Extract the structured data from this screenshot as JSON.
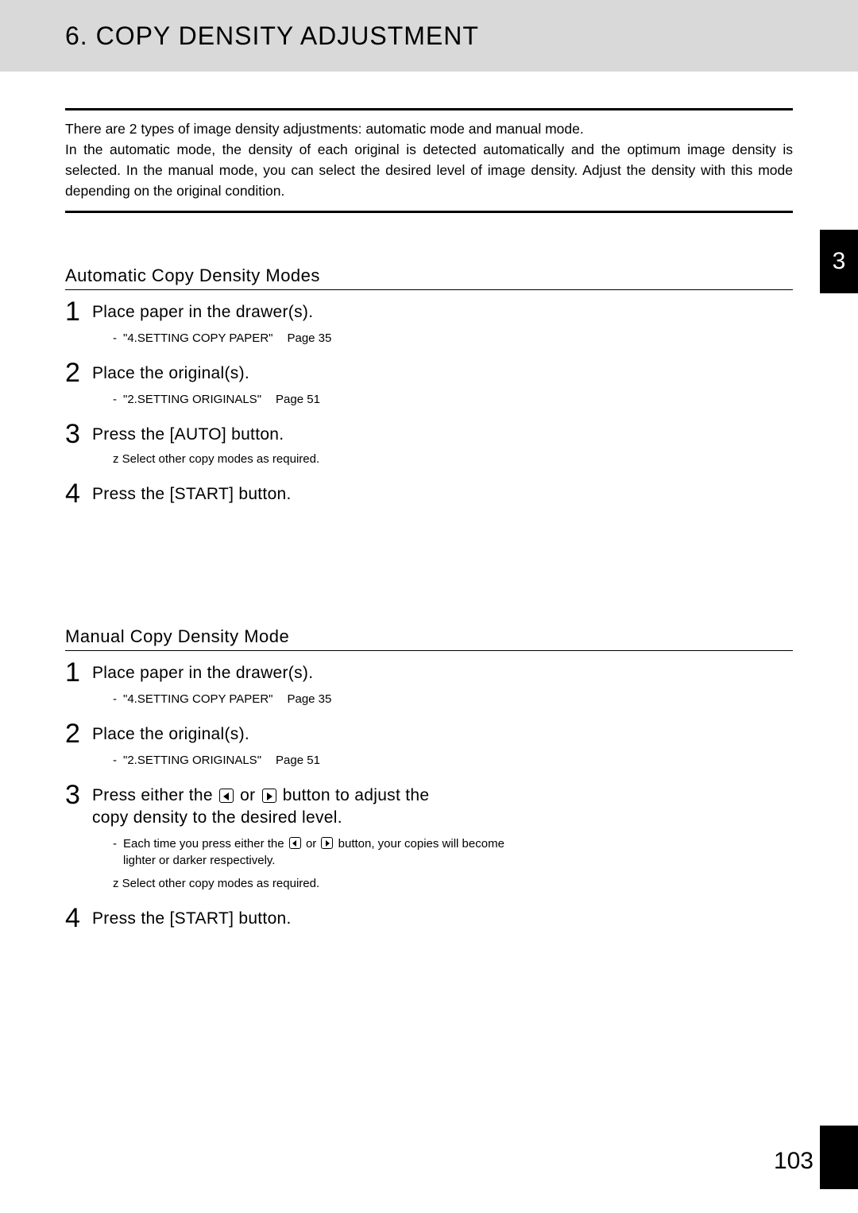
{
  "header": {
    "title": "6. COPY DENSITY ADJUSTMENT"
  },
  "chapter_tab": "3",
  "page_number": "103",
  "intro": {
    "p1": "There are 2 types of image density adjustments: automatic mode and manual mode.",
    "p2": "In the automatic mode, the density of each original is detected automatically and the optimum image density is selected. In the manual mode, you can select the desired level of image density. Adjust the density with this mode depending on the original condition."
  },
  "auto": {
    "heading": "Automatic Copy Density Modes",
    "steps": {
      "s1": {
        "num": "1",
        "title": "Place paper in the drawer(s).",
        "ref": "\"4.SETTING COPY PAPER\"",
        "page": "Page 35"
      },
      "s2": {
        "num": "2",
        "title": "Place the original(s).",
        "ref": "\"2.SETTING ORIGINALS\"",
        "page": "Page 51"
      },
      "s3": {
        "num": "3",
        "title": "Press the [AUTO] button.",
        "note_prefix": "z",
        "note": "Select other copy modes as required."
      },
      "s4": {
        "num": "4",
        "title": "Press the [START] button."
      }
    }
  },
  "manual": {
    "heading": "Manual Copy Density Mode",
    "steps": {
      "s1": {
        "num": "1",
        "title": "Place paper in the drawer(s).",
        "ref": "\"4.SETTING COPY PAPER\"",
        "page": "Page 35"
      },
      "s2": {
        "num": "2",
        "title": "Place the original(s).",
        "ref": "\"2.SETTING ORIGINALS\"",
        "page": "Page 51"
      },
      "s3": {
        "num": "3",
        "title_a": "Press either the ",
        "title_b": " or ",
        "title_c": " button to adjust the copy density to the desired level.",
        "sub_a": "Each time you press either the ",
        "sub_b": " or ",
        "sub_c": " button, your copies will become lighter or darker respectively.",
        "note_prefix": "z",
        "note": "Select other copy modes as required."
      },
      "s4": {
        "num": "4",
        "title": "Press the [START] button."
      }
    }
  }
}
